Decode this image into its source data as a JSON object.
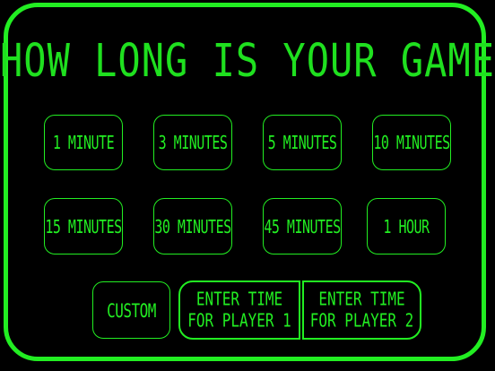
{
  "title": "HOW LONG IS YOUR GAME?",
  "options": [
    {
      "label": "1 MINUTE"
    },
    {
      "label": "3 MINUTES"
    },
    {
      "label": "5 MINUTES"
    },
    {
      "label": "10 MINUTES"
    },
    {
      "label": "15 MINUTES"
    },
    {
      "label": "30 MINUTES"
    },
    {
      "label": "45 MINUTES"
    },
    {
      "label": "1 HOUR"
    }
  ],
  "custom_label": "CUSTOM",
  "player1": {
    "line1": "ENTER TIME",
    "line2": "FOR PLAYER 1"
  },
  "player2": {
    "line1": "ENTER TIME",
    "line2": "FOR PLAYER 2"
  },
  "colors": {
    "accent": "#22ee22",
    "background": "#000000"
  }
}
